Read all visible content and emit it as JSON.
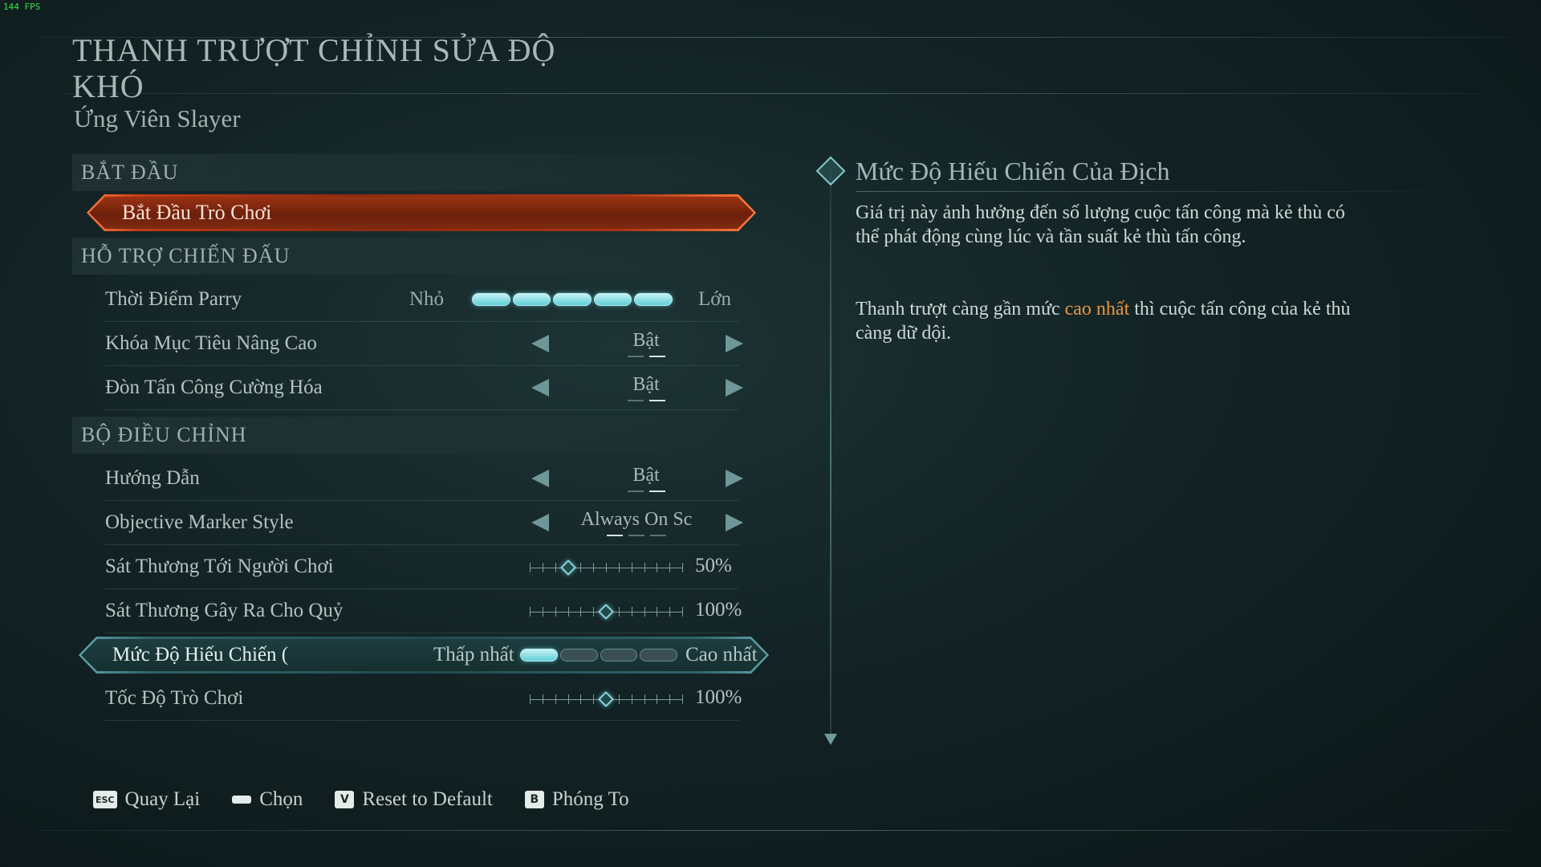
{
  "fps": "144 FPS",
  "header": {
    "title": "THANH TRƯỢT CHỈNH SỬA ĐỘ KHÓ",
    "subtitle": "Ứng Viên Slayer"
  },
  "sections": {
    "start": "BẮT ĐẦU",
    "combat": "HỖ TRỢ CHIẾN ĐẤU",
    "modifiers": "BỘ ĐIỀU CHỈNH"
  },
  "start_button": "Bắt Đầu Trò Chơi",
  "combat_rows": {
    "parry": {
      "label": "Thời Điểm Parry",
      "min": "Nhỏ",
      "max": "Lớn",
      "level": 5,
      "segments": 5
    },
    "target_lock": {
      "label": "Khóa Mục Tiêu Nâng Cao",
      "value": "Bật"
    },
    "empowered": {
      "label": "Đòn Tấn Công Cường Hóa",
      "value": "Bật"
    }
  },
  "modifier_rows": {
    "tutorials": {
      "label": "Hướng Dẫn",
      "value": "Bật"
    },
    "marker": {
      "label": "Objective Marker Style",
      "value": "Always On Sc"
    },
    "damage_taken": {
      "label": "Sát Thương Tới Người Chơi",
      "value": "50%",
      "percent": 50
    },
    "damage_dealt": {
      "label": "Sát Thương Gây Ra Cho Quỷ",
      "value": "100%",
      "percent": 100
    },
    "aggression": {
      "label": "Mức Độ Hiếu Chiến (",
      "min": "Thấp nhất",
      "max": "Cao nhất",
      "level": 1,
      "segments": 4
    },
    "game_speed": {
      "label": "Tốc Độ Trò Chơi",
      "value": "100%",
      "percent": 100
    }
  },
  "info": {
    "title": "Mức Độ Hiếu Chiến Của Địch",
    "p1": "Giá trị này ảnh hưởng đến số lượng cuộc tấn công mà kẻ thù có thể phát động cùng lúc và tần suất kẻ thù tấn công.",
    "p2_before": "Thanh trượt càng gần mức ",
    "p2_highlight": "cao nhất",
    "p2_after": " thì cuộc tấn công của kẻ thù càng dữ dội."
  },
  "footer": {
    "back": {
      "key": "ESC",
      "label": "Quay Lại"
    },
    "select": {
      "key": "",
      "label": "Chọn"
    },
    "reset": {
      "key": "V",
      "label": "Reset to Default"
    },
    "zoom": {
      "key": "B",
      "label": "Phóng To"
    }
  },
  "colors": {
    "accent_orange": "#e6973f",
    "selected_teal": "#5fa7ad",
    "start_orange": "#ff7a3c"
  }
}
